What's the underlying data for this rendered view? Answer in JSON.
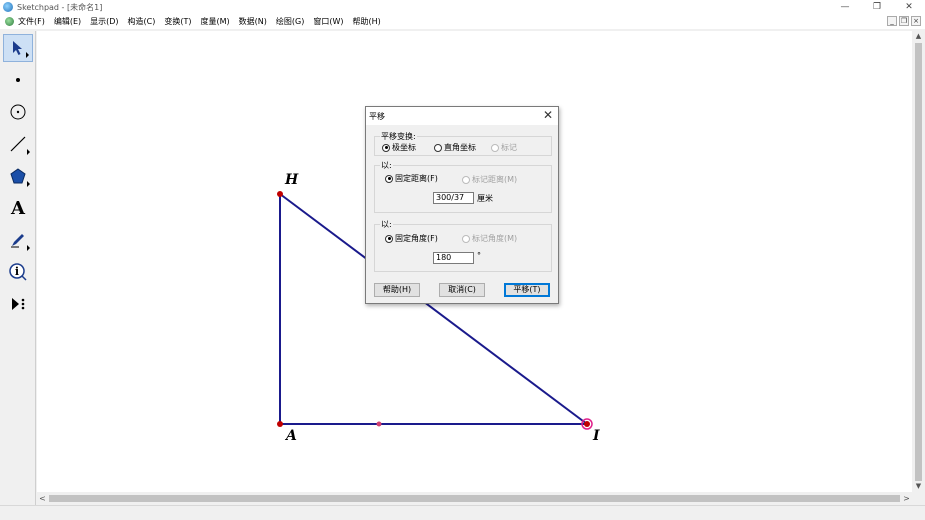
{
  "window": {
    "title": "Sketchpad - [未命名1]",
    "controls": {
      "minimize": "—",
      "restore": "❐",
      "close": "✕"
    }
  },
  "menu": {
    "items": [
      "文件(F)",
      "编辑(E)",
      "显示(D)",
      "构造(C)",
      "变换(T)",
      "度量(M)",
      "数据(N)",
      "绘图(G)",
      "窗口(W)",
      "帮助(H)"
    ],
    "mdi_controls": {
      "minimize": "_",
      "restore": "❐",
      "close": "×"
    }
  },
  "toolbox": {
    "tools": [
      "select-arrow-icon",
      "point-icon",
      "compass-icon",
      "straightedge-icon",
      "polygon-icon",
      "text-icon",
      "marker-icon",
      "information-icon",
      "custom-tool-icon"
    ],
    "text_tool_glyph": "A",
    "info_tool_glyph": "i"
  },
  "canvas": {
    "labels": {
      "H": "H",
      "A": "A",
      "I": "I"
    },
    "colors": {
      "segment": "#1a1a8c",
      "point": "#c00000",
      "midpoint": "#d04070",
      "selected_ring": "#e0208a"
    }
  },
  "scroll": {
    "up": "▲",
    "down": "▼",
    "left": "<",
    "right": ">"
  },
  "dialog": {
    "title": "平移",
    "close": "✕",
    "transform_group": {
      "label": "平移变换:",
      "polar": "极坐标",
      "rect": "直角坐标",
      "marked": "标记"
    },
    "distance_group": {
      "label": "以:",
      "fixed": "固定距离(F)",
      "marked": "标记距离(M)",
      "value": "300/37",
      "unit": "厘米"
    },
    "angle_group": {
      "label": "以:",
      "fixed": "固定角度(F)",
      "marked": "标记角度(M)",
      "value": "180",
      "unit": "°"
    },
    "buttons": {
      "help": "帮助(H)",
      "cancel": "取消(C)",
      "translate": "平移(T)"
    }
  }
}
